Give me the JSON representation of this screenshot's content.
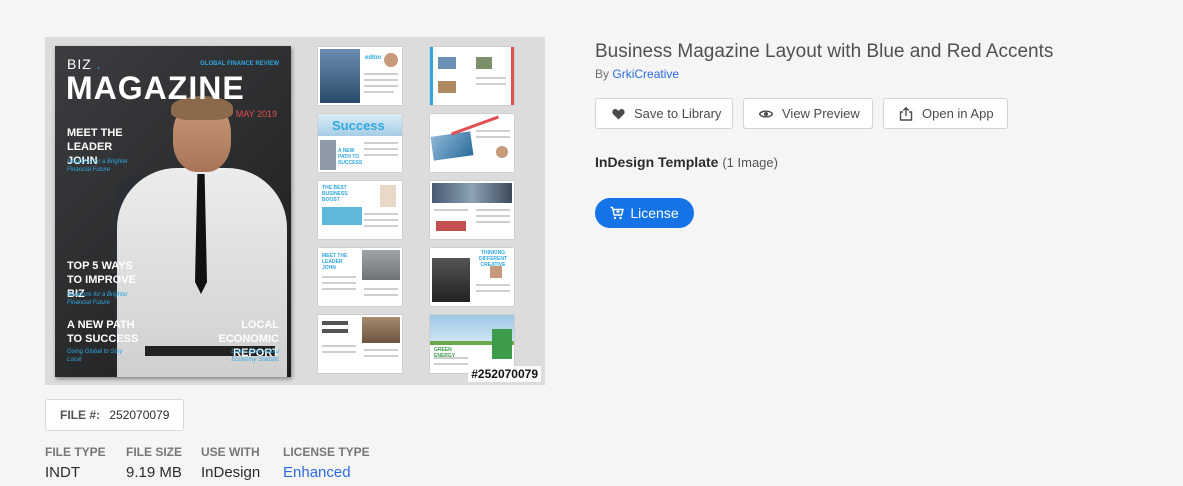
{
  "preview": {
    "cover": {
      "brand_small": "BIZ",
      "brand_dot": ".",
      "tagline": "GLOBAL FINANCE REVIEW",
      "masthead": "MAGAZINE",
      "issue_date": "MAY 2019",
      "headline1": "MEET THE LEADER JOHN",
      "sub1": "Solutions for a Brighter Financial Future",
      "headline2": "TOP 5 WAYS TO IMPROVE BIZ",
      "sub2": "Solutions for a Brighter Financial Future",
      "headline3": "A NEW PATH TO SUCCESS",
      "sub3": "Going Global to Stay Local",
      "headline4": "LOCAL ECONOMIC REPORT",
      "sub4": "Learn More About Economy Statistic"
    },
    "spread_texts": [
      "editor",
      "Success",
      "A NEW PATH TO SUCCESS",
      "THE BEST BUSINESS BOOST",
      "MEET THE LEADER JOHN",
      "THINKING DIFFERENT CREATIVE",
      "GREEN ENERGY"
    ],
    "file_id_overlay": "#252070079"
  },
  "file": {
    "number_label": "FILE #:",
    "number_value": "252070079",
    "meta": [
      {
        "key": "FILE TYPE",
        "value": "INDT"
      },
      {
        "key": "FILE SIZE",
        "value": "9.19 MB"
      },
      {
        "key": "USE WITH",
        "value": "InDesign"
      },
      {
        "key": "LICENSE TYPE",
        "value": "Enhanced"
      }
    ]
  },
  "asset": {
    "title": "Business Magazine Layout with Blue and Red Accents",
    "by_prefix": "By",
    "author": "GrkiCreative",
    "template_type": "InDesign Template",
    "image_count": "(1 Image)"
  },
  "actions": {
    "save_label": "Save to Library",
    "preview_label": "View Preview",
    "open_label": "Open in App",
    "license_label": "License"
  },
  "icons": {
    "save": "heart-icon",
    "preview": "eye-icon",
    "open": "share-icon",
    "license": "cart-icon"
  },
  "colors": {
    "accent": "#1473e6",
    "link": "#2d6cdf",
    "cover_blue": "#2fa8e0",
    "cover_red": "#e05050"
  }
}
